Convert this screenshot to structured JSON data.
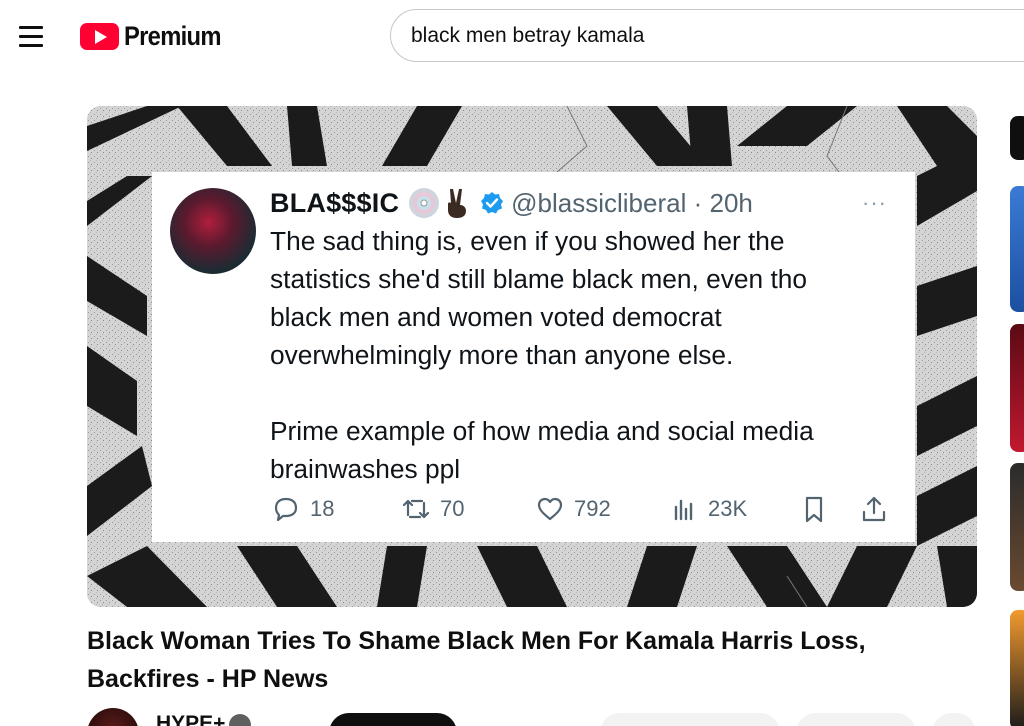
{
  "header": {
    "logo_text": "Premium",
    "search_value": "black men betray kamala"
  },
  "tweet": {
    "display_name": "BLA$$$IC",
    "handle_time": "@blassicliberal · 20h",
    "more": "···",
    "text": "The sad thing is, even if you showed her the\nstatistics she'd still blame black men, even tho\nblack men and women voted democrat\noverwhelmingly more than anyone else.\n\nPrime example of how media and social media\nbrainwashes ppl",
    "replies": "18",
    "reposts": "70",
    "likes": "792",
    "views": "23K"
  },
  "video": {
    "title": "Black Woman Tries To Shame Black Men For Kamala Harris Loss, Backfires - HP News",
    "channel": "HYPE+"
  },
  "colors": {
    "brand_red": "#ff0033",
    "tweet_text": "#0f1419",
    "tweet_muted": "#536471",
    "verified_blue": "#1d9bf0"
  },
  "icons": [
    "menu-icon",
    "youtube-logo-icon",
    "disc-icon",
    "peace-hand-icon",
    "verified-badge-icon",
    "more-icon",
    "reply-icon",
    "repost-icon",
    "like-icon",
    "views-icon",
    "bookmark-icon",
    "share-icon",
    "verified-check-icon"
  ]
}
